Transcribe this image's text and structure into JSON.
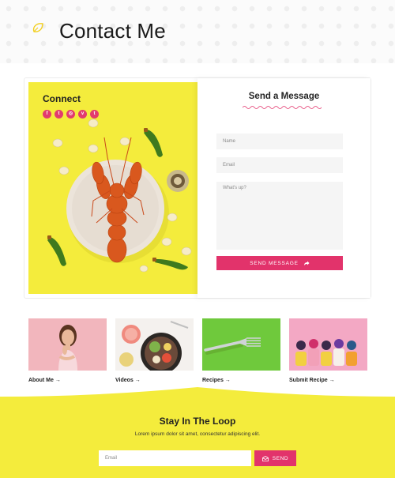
{
  "header": {
    "title": "Contact Me",
    "icon": "leaf-icon"
  },
  "connect": {
    "title": "Connect",
    "socials": [
      {
        "icon": "facebook-icon",
        "glyph": "f"
      },
      {
        "icon": "twitter-icon",
        "glyph": "t"
      },
      {
        "icon": "instagram-icon",
        "glyph": "◎"
      },
      {
        "icon": "vine-icon",
        "glyph": "v"
      },
      {
        "icon": "tumblr-icon",
        "glyph": "t"
      }
    ]
  },
  "form": {
    "title": "Send a Message",
    "name_placeholder": "Name",
    "email_placeholder": "Email",
    "message_placeholder": "What's up?",
    "send_label": "SEND MESSAGE"
  },
  "thumbs": [
    {
      "label": "About Me →"
    },
    {
      "label": "Videos →"
    },
    {
      "label": "Recipes →"
    },
    {
      "label": "Submit Recipe →"
    }
  ],
  "newsletter": {
    "title": "Stay In The Loop",
    "text": "Lorem ipsum dolor sit amet, consectetur adipiscing elit.",
    "email_placeholder": "Email",
    "send_label": "SEND"
  },
  "colors": {
    "accent": "#e2336b",
    "yellow": "#f4ec3c"
  }
}
